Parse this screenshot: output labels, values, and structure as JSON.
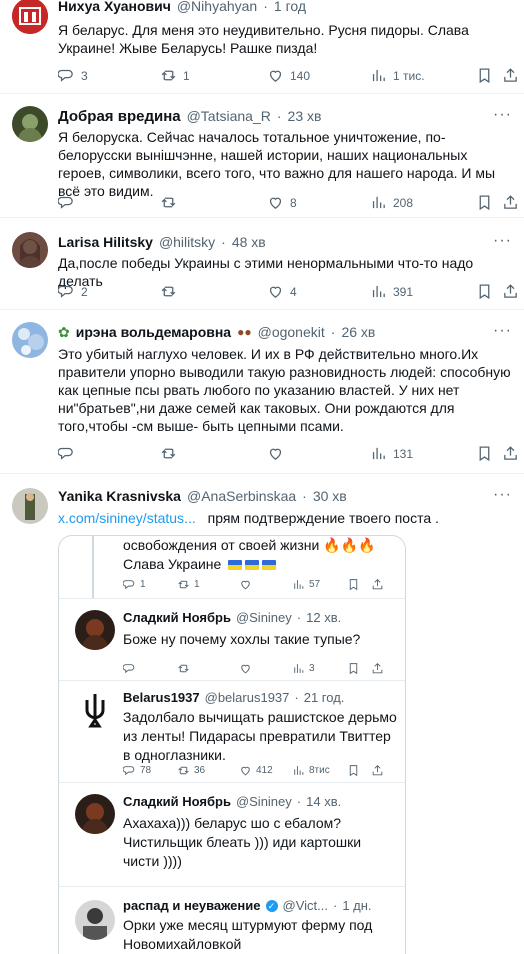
{
  "tweets": [
    {
      "name": "Нихуа Хуанович",
      "handle": "@Nihyahyan",
      "time": "1 год",
      "text": "Я беларус. Для меня это неудивительно. Русня пидоры. Слава Украине! Жыве Беларусь! Рашке пизда!",
      "replies": "3",
      "retweets": "1",
      "likes": "140",
      "views": "1 тис."
    },
    {
      "name": "Добрая вредина",
      "handle": "@Tatsiana_R",
      "time": "23 хв",
      "text": "Я белоруска. Сейчас началось тотальное уничтожение, по- белорусски вынішчэнне, нашей истории, наших национальных героев, символики, всего того, что важно для нашего народа. И мы всё это видим.",
      "replies": "",
      "retweets": "",
      "likes": "8",
      "views": "208"
    },
    {
      "name": "Larisa Hilitsky",
      "handle": "@hilitsky",
      "time": "48 хв",
      "text": "Да,после победы Украины с этими ненормальными что-то надо делать",
      "replies": "2",
      "retweets": "",
      "likes": "4",
      "views": "391"
    },
    {
      "name": "ирэна вольдемаровна",
      "handle": "@ogonekit",
      "time": "26 хв",
      "text": "Это убитый наглухо человек. И их в РФ действительно много.Их правители упорно выводили такую разновидность людей: способную как цепные псы рвать любого по указанию властей. У них нет ни\"братьев\",ни даже семей как таковых. Они рождаются для того,чтобы -см выше- быть цепными псами.",
      "replies": "",
      "retweets": "",
      "likes": "",
      "views": "131"
    },
    {
      "name": "Yanika Krasnivska",
      "handle": "@AnaSerbinskaa",
      "time": "30 хв",
      "link": "x.com/sininey/status...",
      "text": "прям  подтверждение твоего поста ."
    }
  ],
  "embedded": {
    "top_text_1": "освобождения от своей жизни",
    "top_text_2": "Слава Украине",
    "top_replies": "1",
    "top_retweets": "1",
    "top_views": "57",
    "posts": [
      {
        "name": "Сладкий Ноябрь",
        "handle": "@Sininey",
        "time": "12 хв.",
        "text": "Боже ну почему хохлы такие тупые?",
        "views": "3"
      },
      {
        "name": "Belarus1937",
        "handle": "@belarus1937",
        "time": "21 год.",
        "text": "Задолбало вычищать рашистское дерьмо из ленты! Пидарасы превратили Твиттер в одноглазники.",
        "replies": "78",
        "retweets": "36",
        "likes": "412",
        "views": "8тис"
      },
      {
        "name": "Сладкий Ноябрь",
        "handle": "@Sininey",
        "time": "14 хв.",
        "text": "Ахахаха))) беларус шо с ебалом? Чистильщик блеать ))) иди картошки чисти ))))"
      },
      {
        "name": "распад и неуважение",
        "handle": "@Vict...",
        "time": "1 дн.",
        "text": "Орки уже месяц штурмуют ферму под Новомихайловкой"
      }
    ]
  },
  "colors": {
    "accent": "#1d9bf0",
    "text": "#0f1419",
    "muted": "#536471",
    "divider": "#eff3f4"
  }
}
